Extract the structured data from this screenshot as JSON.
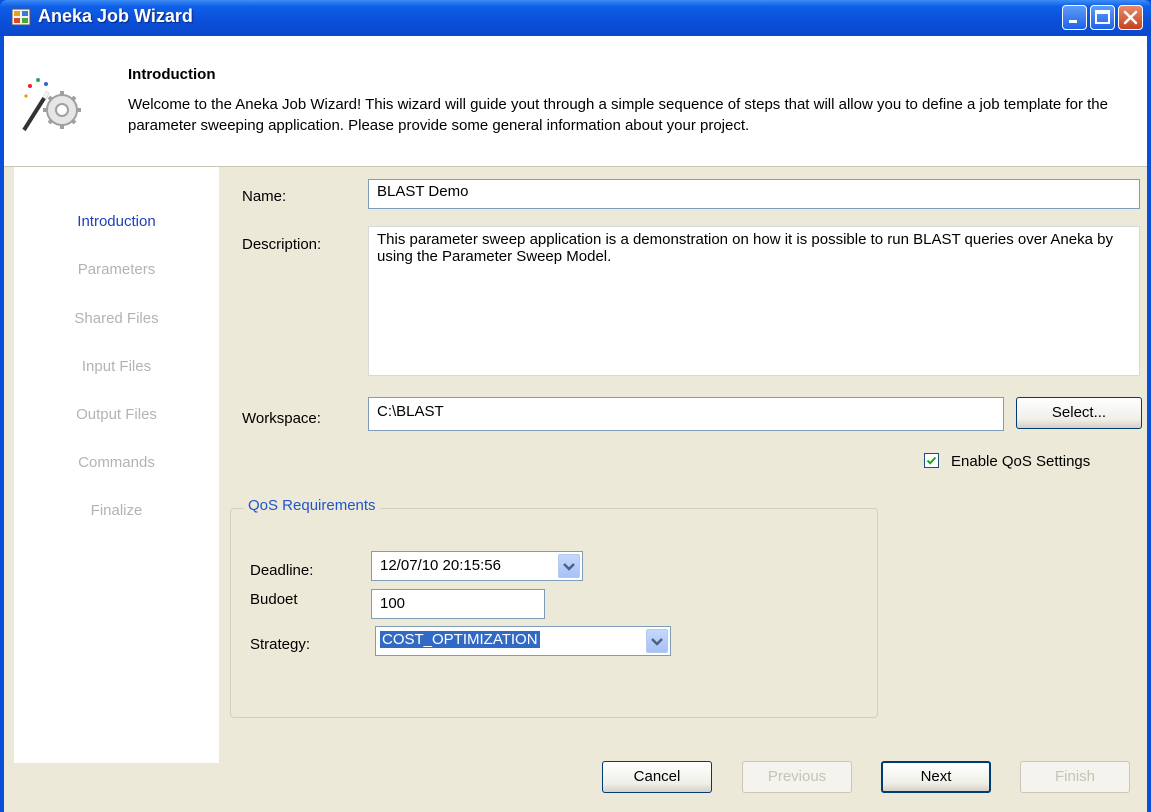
{
  "window": {
    "title": "Aneka Job Wizard"
  },
  "header": {
    "title": "Introduction",
    "description": "Welcome to the Aneka Job Wizard! This wizard will guide yout through a simple sequence of steps that will allow you to define a job template for the parameter sweeping application. Please provide some general information about your project."
  },
  "sidebar": {
    "steps": [
      {
        "label": "Introduction",
        "active": true
      },
      {
        "label": "Parameters",
        "active": false
      },
      {
        "label": "Shared Files",
        "active": false
      },
      {
        "label": "Input Files",
        "active": false
      },
      {
        "label": "Output Files",
        "active": false
      },
      {
        "label": "Commands",
        "active": false
      },
      {
        "label": "Finalize",
        "active": false
      }
    ]
  },
  "form": {
    "name_label": "Name:",
    "name_value": "BLAST Demo",
    "description_label": "Description:",
    "description_value": "This parameter sweep application is a demonstration on how it is possible to run BLAST queries over Aneka by using the Parameter Sweep Model.",
    "workspace_label": "Workspace:",
    "workspace_value": "C:\\BLAST",
    "select_button": "Select...",
    "qos_checkbox_label": "Enable QoS Settings",
    "qos_checkbox_checked": true
  },
  "qos": {
    "group_title": "QoS Requirements",
    "deadline_label": "Deadline:",
    "deadline_value": "12/07/10 20:15:56",
    "budget_label": "Budoet",
    "budget_value": "100",
    "strategy_label": "Strategy:",
    "strategy_value": "COST_OPTIMIZATION"
  },
  "footer": {
    "cancel": "Cancel",
    "previous": "Previous",
    "next": "Next",
    "finish": "Finish"
  },
  "colors": {
    "titlebar": "#0a4fd8",
    "dialog_bg": "#ece9d8",
    "active_step": "#1f3fbf",
    "inactive_step": "#b3b3b3",
    "group_title": "#2155c7",
    "selection": "#316ac5"
  },
  "icons": {
    "app": "aneka-app-icon",
    "wizard": "wizard-wand-gear-icon",
    "minimize": "minimize-icon",
    "maximize": "maximize-icon",
    "close": "close-icon",
    "dropdown": "chevron-down-icon",
    "check": "checkmark-icon"
  }
}
